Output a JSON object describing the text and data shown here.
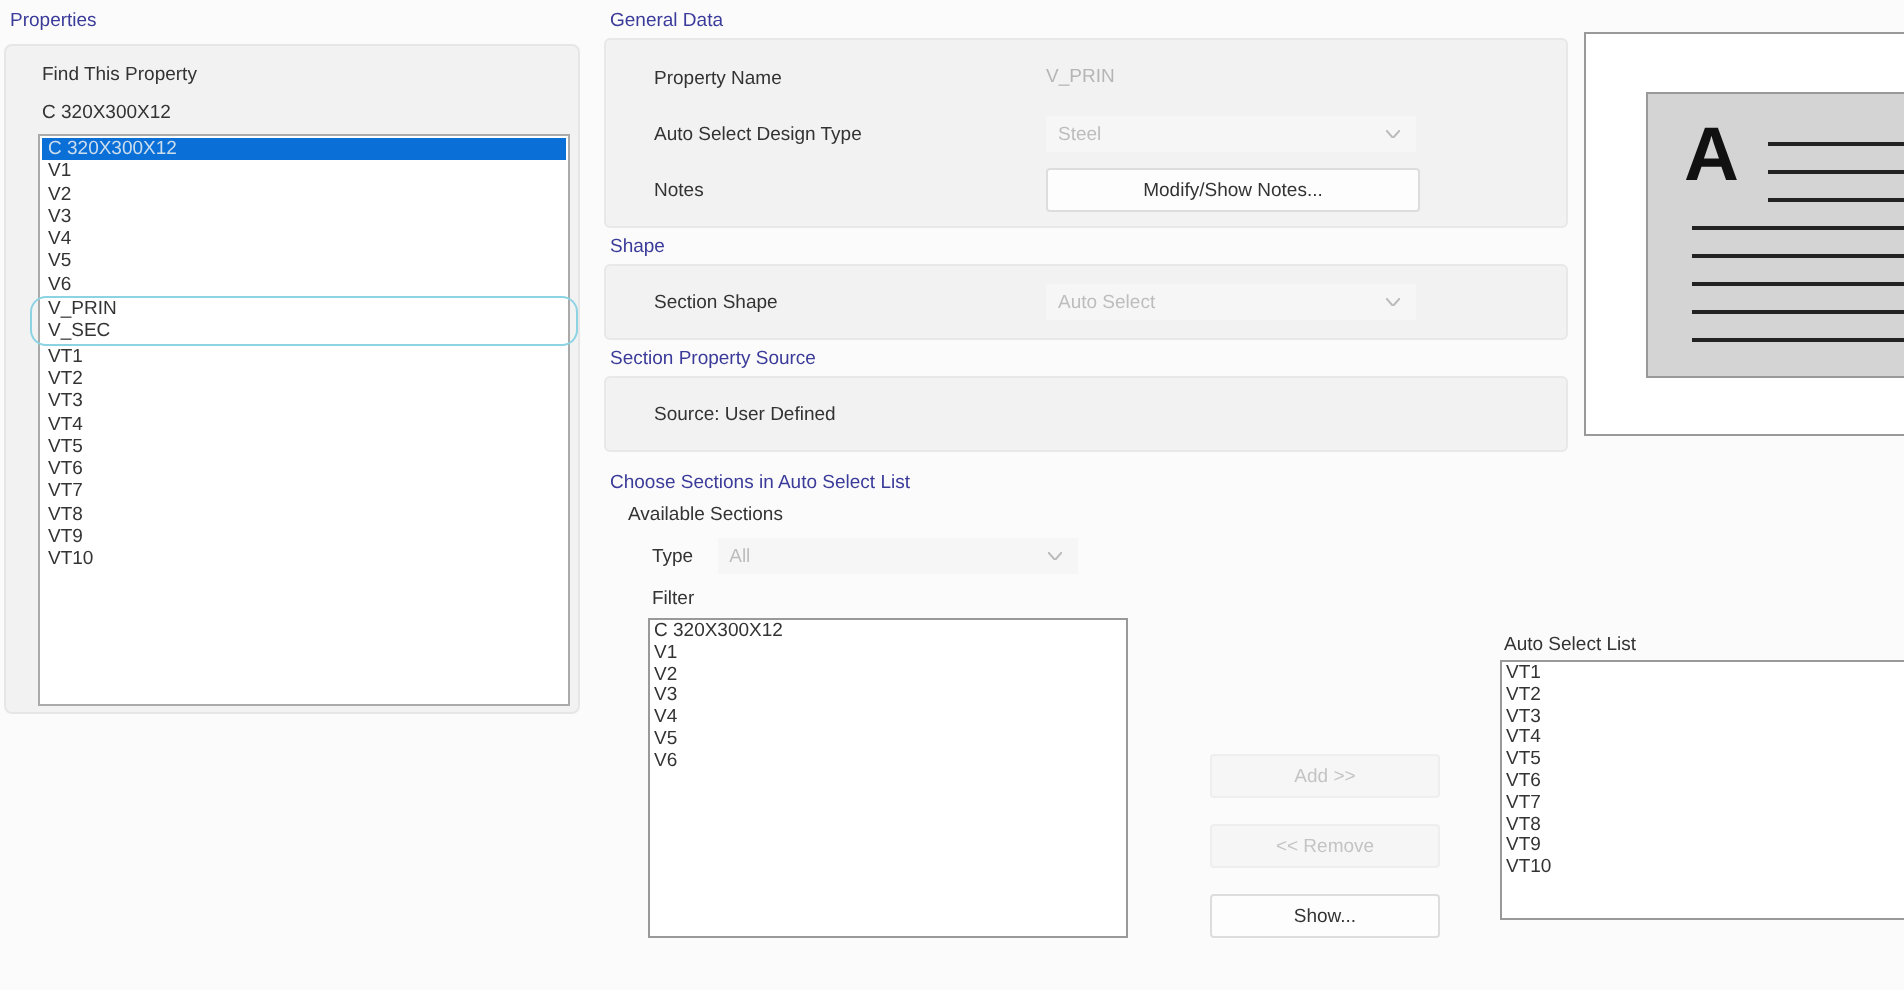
{
  "properties": {
    "title": "Properties",
    "find_label": "Find This Property",
    "find_value": "C 320X300X12",
    "items": [
      {
        "label": "C 320X300X12",
        "selected": true,
        "highlighted": false
      },
      {
        "label": "V1",
        "selected": false,
        "highlighted": false
      },
      {
        "label": "V2",
        "selected": false,
        "highlighted": false
      },
      {
        "label": "V3",
        "selected": false,
        "highlighted": false
      },
      {
        "label": "V4",
        "selected": false,
        "highlighted": false
      },
      {
        "label": "V5",
        "selected": false,
        "highlighted": false
      },
      {
        "label": "V6",
        "selected": false,
        "highlighted": false
      },
      {
        "label": "V_PRIN",
        "selected": false,
        "highlighted": true
      },
      {
        "label": "V_SEC",
        "selected": false,
        "highlighted": true
      },
      {
        "label": "VT1",
        "selected": false,
        "highlighted": false
      },
      {
        "label": "VT2",
        "selected": false,
        "highlighted": false
      },
      {
        "label": "VT3",
        "selected": false,
        "highlighted": false
      },
      {
        "label": "VT4",
        "selected": false,
        "highlighted": false
      },
      {
        "label": "VT5",
        "selected": false,
        "highlighted": false
      },
      {
        "label": "VT6",
        "selected": false,
        "highlighted": false
      },
      {
        "label": "VT7",
        "selected": false,
        "highlighted": false
      },
      {
        "label": "VT8",
        "selected": false,
        "highlighted": false
      },
      {
        "label": "VT9",
        "selected": false,
        "highlighted": false
      },
      {
        "label": "VT10",
        "selected": false,
        "highlighted": false
      }
    ]
  },
  "general_data": {
    "title": "General Data",
    "property_name_label": "Property Name",
    "property_name_value": "V_PRIN",
    "design_type_label": "Auto Select Design Type",
    "design_type_value": "Steel",
    "design_type_disabled": true,
    "notes_label": "Notes",
    "notes_button": "Modify/Show Notes..."
  },
  "shape": {
    "title": "Shape",
    "section_shape_label": "Section Shape",
    "section_shape_value": "Auto Select",
    "section_shape_disabled": true
  },
  "source": {
    "title": "Section Property Source",
    "text": "Source:  User Defined"
  },
  "preview": {
    "glyph": "A"
  },
  "choose": {
    "title": "Choose Sections in Auto Select List",
    "available_title": "Available Sections",
    "type_label": "Type",
    "type_value": "All",
    "type_disabled": true,
    "filter_label": "Filter",
    "available": [
      "C 320X300X12",
      "V1",
      "V2",
      "V3",
      "V4",
      "V5",
      "V6"
    ],
    "buttons": [
      {
        "label": "Add >>",
        "disabled": true
      },
      {
        "label": "<< Remove",
        "disabled": true
      },
      {
        "label": "Show...",
        "disabled": false
      }
    ],
    "auto_list_label": "Auto Select List",
    "auto_list": [
      "VT1",
      "VT2",
      "VT3",
      "VT4",
      "VT5",
      "VT6",
      "VT7",
      "VT8",
      "VT9",
      "VT10"
    ]
  }
}
